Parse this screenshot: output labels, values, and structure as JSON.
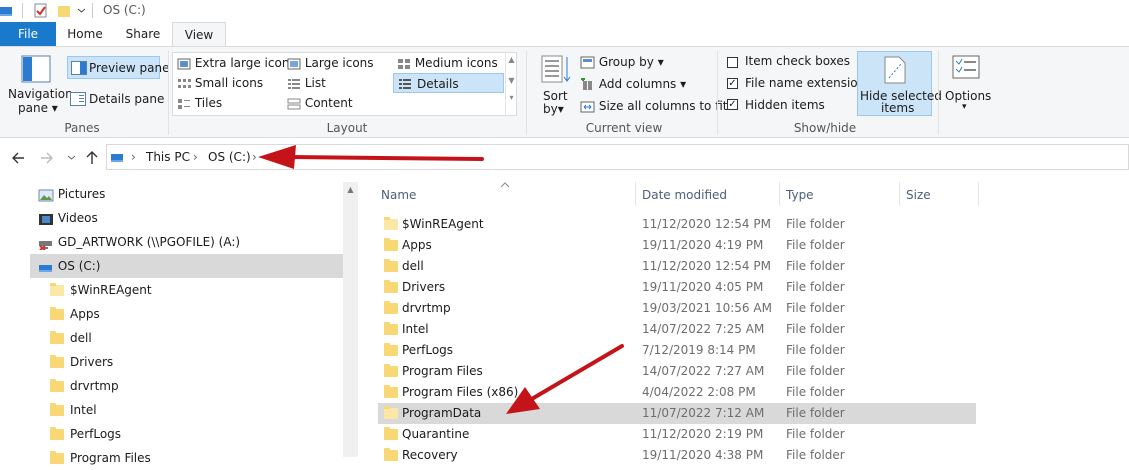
{
  "window": {
    "title": "OS (C:)"
  },
  "tabs": [
    {
      "label": "File"
    },
    {
      "label": "Home"
    },
    {
      "label": "Share"
    },
    {
      "label": "View"
    }
  ],
  "ribbon": {
    "panes": {
      "navigation_pane": "Navigation",
      "navigation_pane_2": "pane",
      "preview_pane": "Preview pane",
      "details_pane": "Details pane",
      "group_label": "Panes"
    },
    "layout": {
      "items": [
        "Extra large icons",
        "Large icons",
        "Medium icons",
        "Small icons",
        "List",
        "Details",
        "Tiles",
        "Content"
      ],
      "group_label": "Layout",
      "selected": "Details"
    },
    "current_view": {
      "sort_by": "Sort",
      "sort_by_2": "by",
      "group_by": "Group by",
      "add_columns": "Add columns",
      "size_all_columns": "Size all columns to fit",
      "group_label": "Current view"
    },
    "show_hide": {
      "item_check_boxes": "Item check boxes",
      "file_name_extensions": "File name extensions",
      "hidden_items": "Hidden items",
      "checked": [
        false,
        true,
        true
      ],
      "hide_selected": "Hide selected",
      "hide_selected_2": "items",
      "group_label": "Show/hide"
    },
    "options": {
      "label": "Options"
    }
  },
  "address": {
    "crumbs": [
      "This PC",
      "OS (C:)"
    ]
  },
  "navpane": {
    "items": [
      {
        "label": "Pictures",
        "icon": "pictures-icon"
      },
      {
        "label": "Videos",
        "icon": "videos-icon"
      },
      {
        "label": "GD_ARTWORK (\\\\PGOFILE) (A:)",
        "icon": "network-drive-icon"
      },
      {
        "label": "OS (C:)",
        "icon": "drive-icon"
      },
      {
        "label": "$WinREAgent",
        "icon": "folder-icon"
      },
      {
        "label": "Apps",
        "icon": "folder-icon"
      },
      {
        "label": "dell",
        "icon": "folder-icon"
      },
      {
        "label": "Drivers",
        "icon": "folder-icon"
      },
      {
        "label": "drvrtmp",
        "icon": "folder-icon"
      },
      {
        "label": "Intel",
        "icon": "folder-icon"
      },
      {
        "label": "PerfLogs",
        "icon": "folder-icon"
      },
      {
        "label": "Program Files",
        "icon": "folder-icon"
      }
    ]
  },
  "filelist": {
    "columns": [
      "Name",
      "Date modified",
      "Type",
      "Size"
    ],
    "rows": [
      {
        "name": "$WinREAgent",
        "date": "11/12/2020 12:54 PM",
        "type": "File folder"
      },
      {
        "name": "Apps",
        "date": "19/11/2020 4:19 PM",
        "type": "File folder"
      },
      {
        "name": "dell",
        "date": "11/12/2020 12:54 PM",
        "type": "File folder"
      },
      {
        "name": "Drivers",
        "date": "19/11/2020 4:05 PM",
        "type": "File folder"
      },
      {
        "name": "drvrtmp",
        "date": "19/03/2021 10:56 AM",
        "type": "File folder"
      },
      {
        "name": "Intel",
        "date": "14/07/2022 7:25 AM",
        "type": "File folder"
      },
      {
        "name": "PerfLogs",
        "date": "7/12/2019 8:14 PM",
        "type": "File folder"
      },
      {
        "name": "Program Files",
        "date": "14/07/2022 7:27 AM",
        "type": "File folder"
      },
      {
        "name": "Program Files (x86)",
        "date": "4/04/2022 2:08 PM",
        "type": "File folder"
      },
      {
        "name": "ProgramData",
        "date": "11/07/2022 7:12 AM",
        "type": "File folder"
      },
      {
        "name": "Quarantine",
        "date": "11/12/2020 2:19 PM",
        "type": "File folder"
      },
      {
        "name": "Recovery",
        "date": "19/11/2020 4:38 PM",
        "type": "File folder"
      }
    ],
    "highlighted": "ProgramData"
  },
  "colors": {
    "accent": "#1979ca",
    "annotation_arrow": "#c4141a",
    "folder": "#f8d775"
  }
}
